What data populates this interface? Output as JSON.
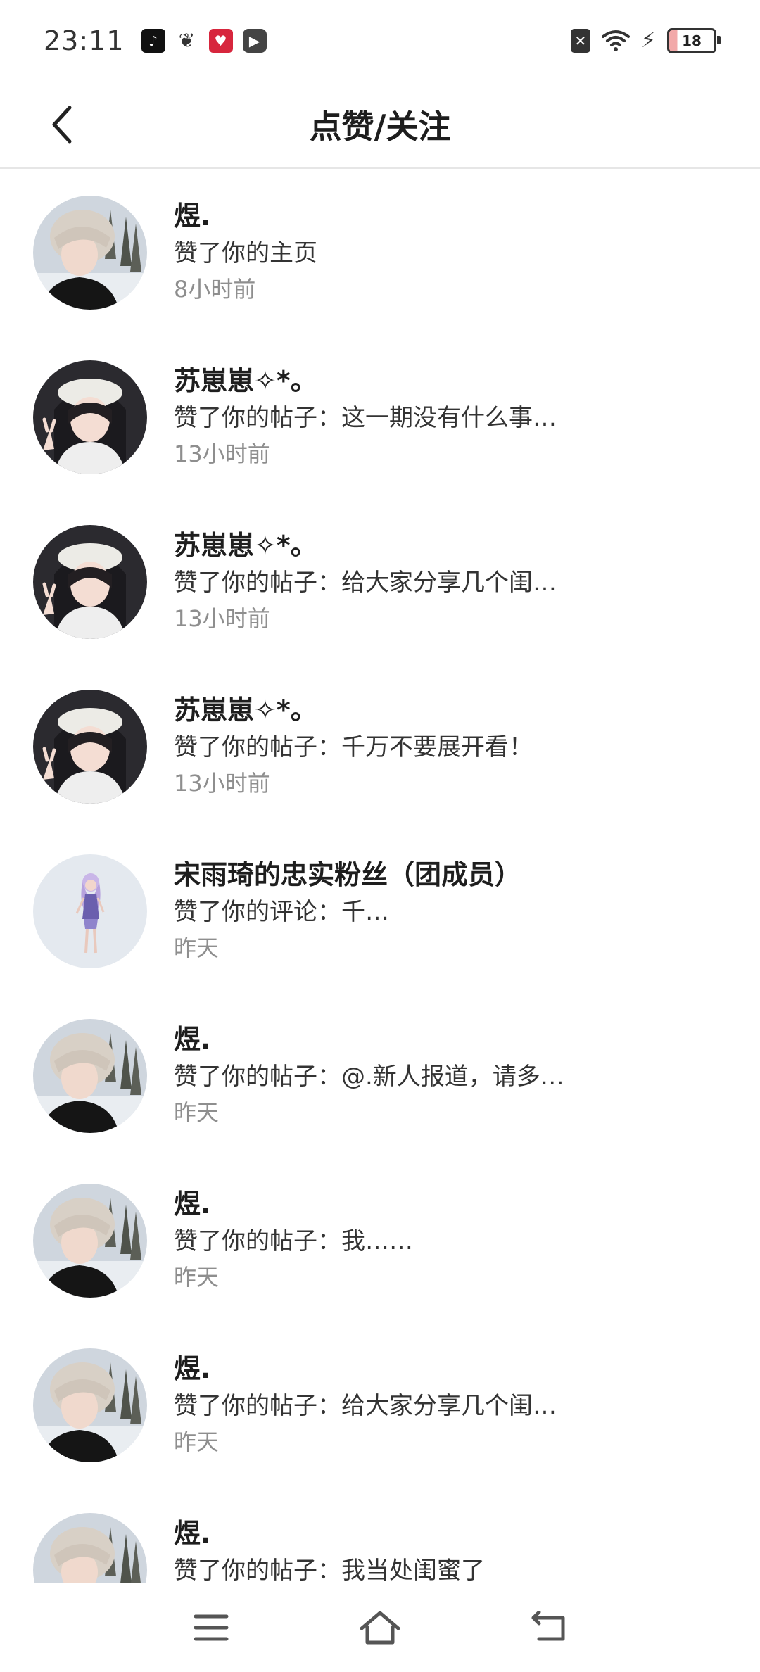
{
  "status_bar": {
    "time": "23:11",
    "battery": "18",
    "icons": [
      "tiktok-icon",
      "leaf-icon",
      "heart-badge-icon",
      "play-icon",
      "sim-off-icon",
      "wifi-icon",
      "charging-icon",
      "battery-icon"
    ]
  },
  "header": {
    "title": "点赞/关注",
    "back_icon": "chevron-left-icon"
  },
  "colors": {
    "name": "#1e1e1e",
    "action": "#333333",
    "time": "#8e8e8e",
    "divider": "#e6e6e6"
  },
  "list": [
    {
      "name": "煜.",
      "action": "赞了你的主页",
      "time": "8小时前",
      "avatar": "user-yu"
    },
    {
      "name": "苏崽崽✧*。",
      "action": "赞了你的帖子：这一期没有什么事…",
      "time": "13小时前",
      "avatar": "user-su"
    },
    {
      "name": "苏崽崽✧*。",
      "action": "赞了你的帖子：给大家分享几个闺…",
      "time": "13小时前",
      "avatar": "user-su"
    },
    {
      "name": "苏崽崽✧*。",
      "action": "赞了你的帖子：千万不要展开看！",
      "time": "13小时前",
      "avatar": "user-su"
    },
    {
      "name": "宋雨琦的忠实粉丝（团成员）",
      "action": "赞了你的评论：千…",
      "time": "昨天",
      "avatar": "user-fan"
    },
    {
      "name": "煜.",
      "action": "赞了你的帖子：@.新人报道，请多…",
      "time": "昨天",
      "avatar": "user-yu"
    },
    {
      "name": "煜.",
      "action": "赞了你的帖子：我……",
      "time": "昨天",
      "avatar": "user-yu"
    },
    {
      "name": "煜.",
      "action": "赞了你的帖子：给大家分享几个闺…",
      "time": "昨天",
      "avatar": "user-yu"
    },
    {
      "name": "煜.",
      "action": "赞了你的帖子：我当处闺蜜了",
      "time": "",
      "avatar": "user-yu"
    }
  ],
  "nav_bar": {
    "icons": [
      "menu-icon",
      "home-icon",
      "back-icon"
    ]
  }
}
